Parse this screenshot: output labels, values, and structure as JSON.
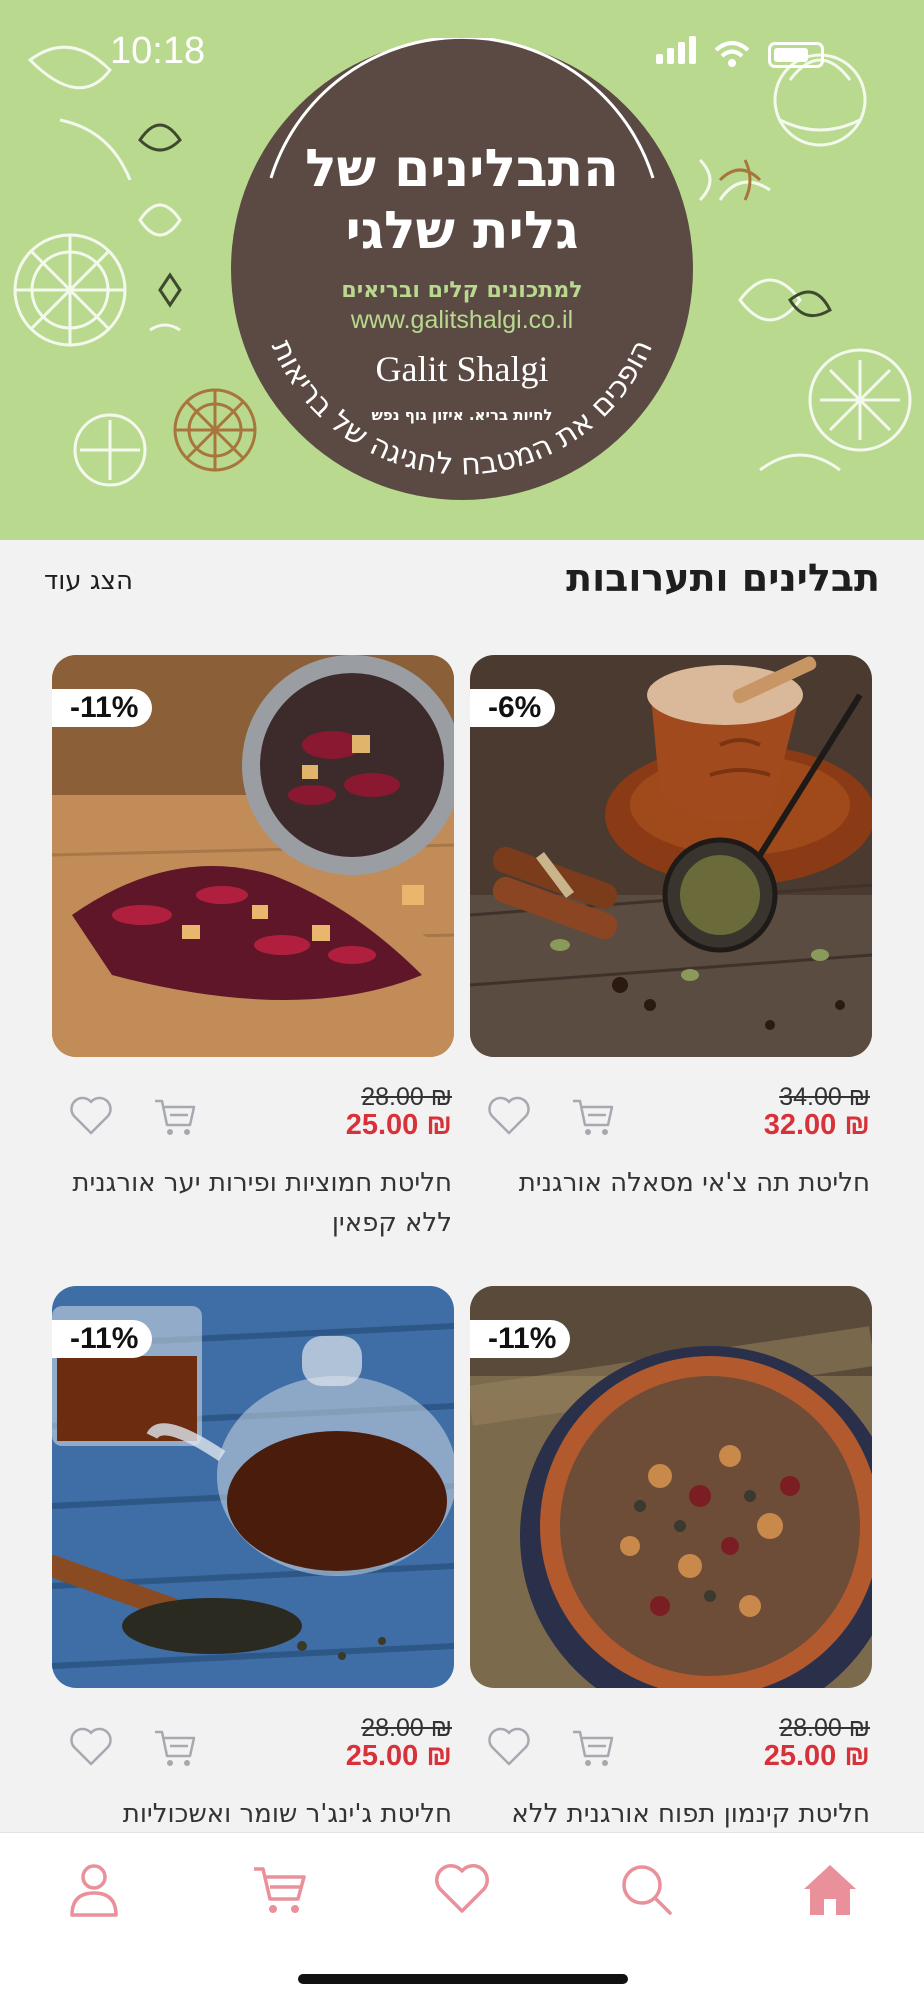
{
  "status_bar": {
    "time": "10:18"
  },
  "banner": {
    "title_line1": "התבלינים של",
    "title_line2": "גלית שלגי",
    "tagline": "למתכונים קלים ובריאים",
    "url": "www.galitshalgi.co.il",
    "brand": "Galit Shalgi",
    "brand_sub": "לחיות בריא. איזון גוף נפש",
    "arc_text": "הופכים את המטבח לחגיגה של בריאות",
    "colors": {
      "background": "#b9d98f",
      "circle": "#5a4a43"
    }
  },
  "section": {
    "title": "תבלינים ותערובות",
    "show_more": "הצג עוד"
  },
  "products": [
    {
      "name": "חליטת תה צ'אי מסאלה אורגנית",
      "old_price": "34.00 ₪",
      "new_price": "32.00 ₪",
      "discount": "-6%",
      "image": "chai-tea-photo"
    },
    {
      "name": "חליטת חמוציות ופירות יער אורגנית ללא קפאין",
      "old_price": "28.00 ₪",
      "new_price": "25.00 ₪",
      "discount": "-11%",
      "image": "berry-tea-photo"
    },
    {
      "name": "חליטת קינמון תפוח אורגנית ללא",
      "old_price": "28.00 ₪",
      "new_price": "25.00 ₪",
      "discount": "-11%",
      "image": "apple-cinnamon-tea-photo"
    },
    {
      "name": "חליטת ג'ינג'ר שומר ואשכוליות",
      "old_price": "28.00 ₪",
      "new_price": "25.00 ₪",
      "discount": "-11%",
      "image": "teapot-photo"
    }
  ],
  "tabbar": {
    "items": [
      "home-icon",
      "search-icon",
      "heart-icon",
      "cart-icon",
      "user-icon"
    ],
    "active": "home-icon",
    "colors": {
      "icon": "#e9909a",
      "price": "#d7323a"
    }
  }
}
